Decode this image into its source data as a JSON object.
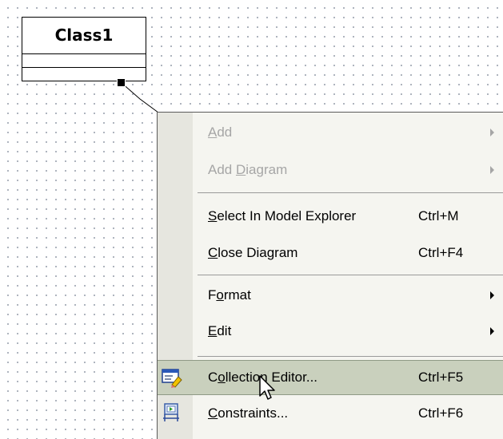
{
  "diagram": {
    "class_name": "Class1"
  },
  "menu": {
    "items": [
      {
        "label_pre": "",
        "mnemonic": "A",
        "label_post": "dd",
        "shortcut": "",
        "disabled": true,
        "submenu": true
      },
      {
        "label_pre": "Add ",
        "mnemonic": "D",
        "label_post": "iagram",
        "shortcut": "",
        "disabled": true,
        "submenu": true
      },
      {
        "label_pre": "",
        "mnemonic": "S",
        "label_post": "elect In Model Explorer",
        "shortcut": "Ctrl+M",
        "disabled": false,
        "submenu": false
      },
      {
        "label_pre": "",
        "mnemonic": "C",
        "label_post": "lose Diagram",
        "shortcut": "Ctrl+F4",
        "disabled": false,
        "submenu": false
      },
      {
        "label_pre": "F",
        "mnemonic": "o",
        "label_post": "rmat",
        "shortcut": "",
        "disabled": false,
        "submenu": true
      },
      {
        "label_pre": "",
        "mnemonic": "E",
        "label_post": "dit",
        "shortcut": "",
        "disabled": false,
        "submenu": true
      },
      {
        "label_pre": "C",
        "mnemonic": "o",
        "label_post": "llection Editor...",
        "shortcut": "Ctrl+F5",
        "disabled": false,
        "submenu": false,
        "highlighted": true,
        "icon": "collection-editor-icon"
      },
      {
        "label_pre": "",
        "mnemonic": "C",
        "label_post": "onstraints...",
        "shortcut": "Ctrl+F6",
        "disabled": false,
        "submenu": false,
        "icon": "constraints-icon"
      }
    ]
  },
  "colors": {
    "menu_background": "#f5f5f0",
    "icon_gutter": "#e6e6df",
    "highlight": "#c9d0bd",
    "disabled_text": "#a6a6a6"
  }
}
